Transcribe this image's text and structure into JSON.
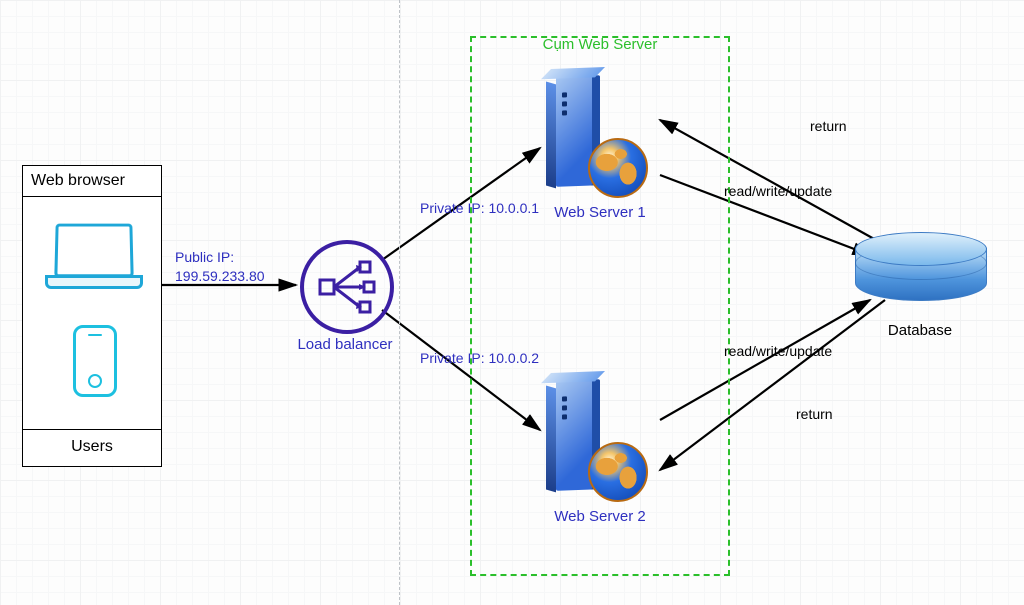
{
  "users_box": {
    "header": "Web browser",
    "footer": "Users"
  },
  "load_balancer": {
    "label": "Load balancer"
  },
  "cluster": {
    "title": "Cụm Web Server"
  },
  "servers": [
    {
      "label": "Web Server 1",
      "private_ip_label": "Private IP: 10.0.0.1"
    },
    {
      "label": "Web Server 2",
      "private_ip_label": "Private IP: 10.0.0.2"
    }
  ],
  "database": {
    "label": "Database"
  },
  "edges": {
    "public_ip": "Public IP:\n199.59.233.80",
    "rw1": "read/write/update",
    "rw2": "read/write/update",
    "ret1": "return",
    "ret2": "return"
  }
}
